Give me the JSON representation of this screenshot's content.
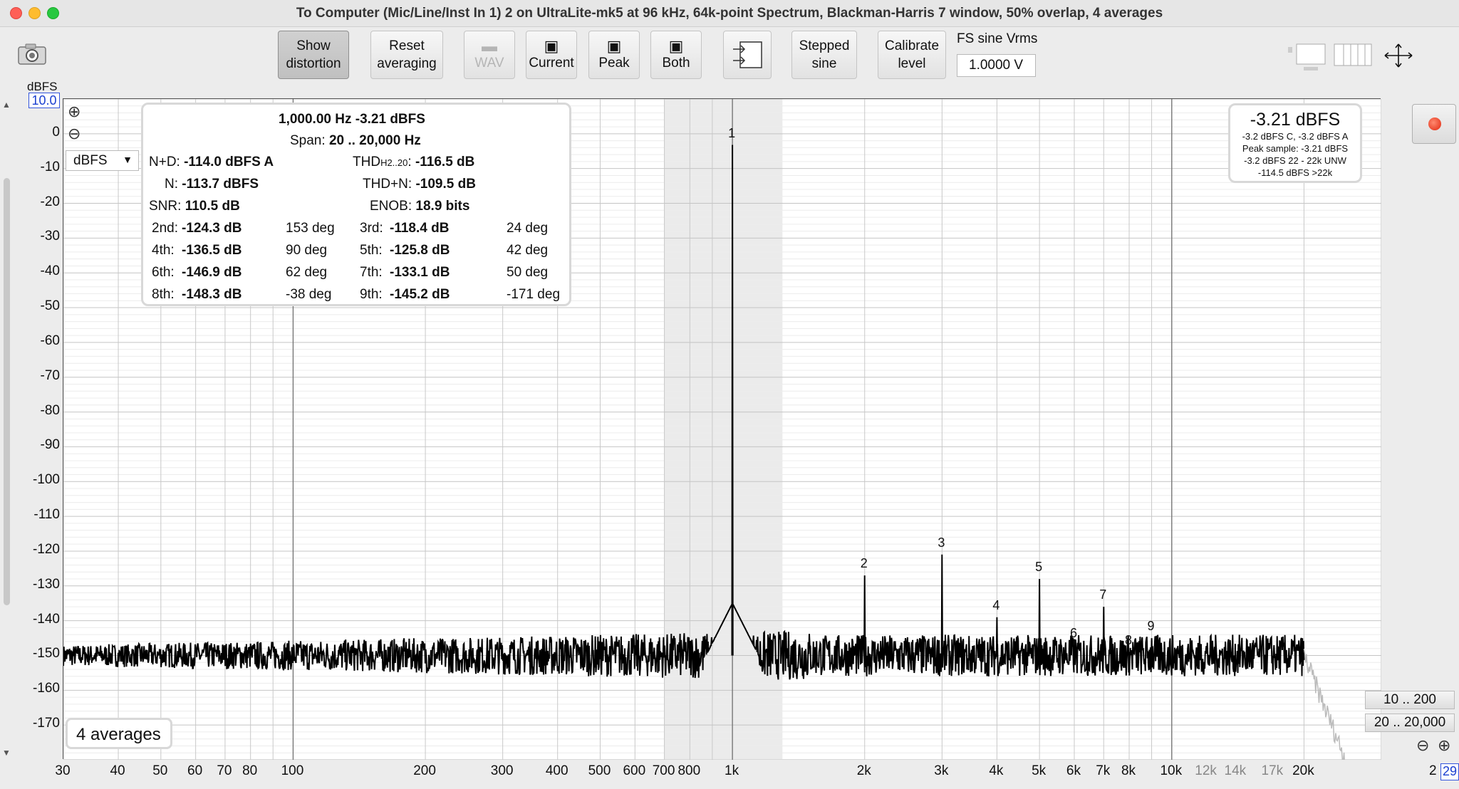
{
  "window": {
    "title": "To Computer (Mic/Line/Inst In 1) 2 on UltraLite-mk5 at 96 kHz, 64k-point Spectrum, Blackman-Harris 7 window, 50% overlap, 4 averages"
  },
  "toolbar": {
    "show_distortion": [
      "Show",
      "distortion"
    ],
    "reset_averaging": [
      "Reset",
      "averaging"
    ],
    "wav": "WAV",
    "current": "Current",
    "peak": "Peak",
    "both": "Both",
    "stepped_sine": [
      "Stepped",
      "sine"
    ],
    "calibrate_level": [
      "Calibrate",
      "level"
    ],
    "fs_label": "FS sine Vrms",
    "fs_value": "1.0000 V"
  },
  "axis": {
    "y_unit": "dBFS",
    "y_top_value": "10.0",
    "y_ticks": [
      "0",
      "-10",
      "-20",
      "-30",
      "-40",
      "-50",
      "-60",
      "-70",
      "-80",
      "-90",
      "-100",
      "-110",
      "-120",
      "-130",
      "-140",
      "-150",
      "-160",
      "-170"
    ],
    "x_major": [
      "30",
      "40",
      "50",
      "60",
      "70",
      "80",
      "100",
      "200",
      "300",
      "400",
      "500",
      "600",
      "700",
      "800",
      "1k",
      "2k",
      "3k",
      "4k",
      "5k",
      "6k",
      "7k",
      "8k",
      "10k",
      "20k"
    ],
    "x_minor": [
      "12k",
      "14k",
      "17k"
    ],
    "x_end": "2",
    "x_end_box": "29"
  },
  "unit_select": "dBFS",
  "info": {
    "header": "1,000.00 Hz  -3.21 dBFS",
    "span_label": "Span:",
    "span_value": "20 .. 20,000 Hz",
    "nd_label": "N+D:",
    "nd_value": "-114.0 dBFS A",
    "thd_label": "THD",
    "thd_sub": "H2..20",
    "thd_colon": ":",
    "thd_value": "-116.5 dB",
    "n_label": "N:",
    "n_value": "-113.7 dBFS",
    "thdn_label": "THD+N:",
    "thdn_value": "-109.5 dB",
    "snr_label": "SNR:",
    "snr_value": "110.5 dB",
    "enob_label": "ENOB:",
    "enob_value": "18.9 bits",
    "harmonics": [
      {
        "l": "2nd:",
        "v": "-124.3 dB",
        "p": "153 deg",
        "l2": "3rd:",
        "v2": "-118.4 dB",
        "p2": "24 deg"
      },
      {
        "l": "4th:",
        "v": "-136.5 dB",
        "p": "90 deg",
        "l2": "5th:",
        "v2": "-125.8 dB",
        "p2": "42 deg"
      },
      {
        "l": "6th:",
        "v": "-146.9 dB",
        "p": "62 deg",
        "l2": "7th:",
        "v2": "-133.1 dB",
        "p2": "50 deg"
      },
      {
        "l": "8th:",
        "v": "-148.3 dB",
        "p": "-38 deg",
        "l2": "9th:",
        "v2": "-145.2 dB",
        "p2": "-171 deg"
      }
    ]
  },
  "level": {
    "main": "-3.21 dBFS",
    "lines": [
      "-3.2 dBFS C, -3.2 dBFS A",
      "Peak sample: -3.21 dBFS",
      "-3.2 dBFS 22 - 22k UNW",
      "-114.5 dBFS >22k"
    ]
  },
  "averages_label": "4 averages",
  "range_buttons": [
    "10 .. 200",
    "20 .. 20,000"
  ],
  "chart_data": {
    "type": "line",
    "xscale": "log",
    "xlim": [
      30,
      30000
    ],
    "ylim": [
      -180,
      10
    ],
    "ylabel": "dBFS",
    "highlight_band": [
      700,
      1300
    ],
    "noise_floor": -150,
    "peaks": [
      {
        "label": "1",
        "freq": 1000,
        "level": -3.21
      },
      {
        "label": "2",
        "freq": 2000,
        "level": -127
      },
      {
        "label": "3",
        "freq": 3000,
        "level": -121
      },
      {
        "label": "4",
        "freq": 4000,
        "level": -139
      },
      {
        "label": "5",
        "freq": 5000,
        "level": -128
      },
      {
        "label": "6",
        "freq": 6000,
        "level": -147
      },
      {
        "label": "7",
        "freq": 7000,
        "level": -136
      },
      {
        "label": "8",
        "freq": 8000,
        "level": -149
      },
      {
        "label": "9",
        "freq": 9000,
        "level": -145
      }
    ]
  }
}
